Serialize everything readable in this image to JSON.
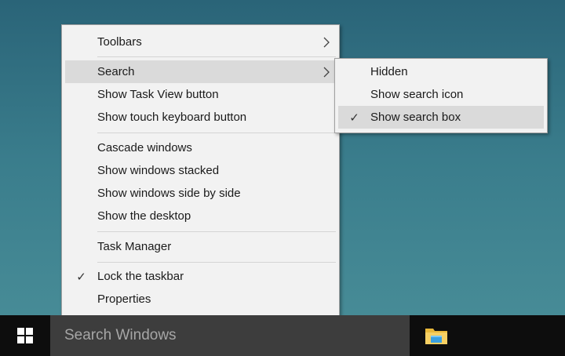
{
  "context_menu": {
    "items": [
      {
        "check": "",
        "label": "Toolbars",
        "submenu": true
      },
      {
        "check": "",
        "label": "Search",
        "submenu": true
      },
      {
        "check": "",
        "label": "Show Task View button"
      },
      {
        "check": "",
        "label": "Show touch keyboard button"
      },
      {
        "check": "",
        "label": "Cascade windows"
      },
      {
        "check": "",
        "label": "Show windows stacked"
      },
      {
        "check": "",
        "label": "Show windows side by side"
      },
      {
        "check": "",
        "label": "Show the desktop"
      },
      {
        "check": "",
        "label": "Task Manager"
      },
      {
        "check": "✓",
        "label": "Lock the taskbar"
      },
      {
        "check": "",
        "label": "Properties"
      }
    ]
  },
  "search_submenu": {
    "items": [
      {
        "check": "",
        "label": "Hidden"
      },
      {
        "check": "",
        "label": "Show search icon"
      },
      {
        "check": "✓",
        "label": "Show search box"
      }
    ]
  },
  "taskbar": {
    "search_placeholder": "Search Windows",
    "start_icon": "windows-logo-icon",
    "pinned_icon": "file-explorer-icon"
  },
  "colors": {
    "taskbar": "#0d0d0d",
    "search_box": "#3d3d3d",
    "menu_bg": "#f2f2f2",
    "highlight": "#dadada"
  }
}
